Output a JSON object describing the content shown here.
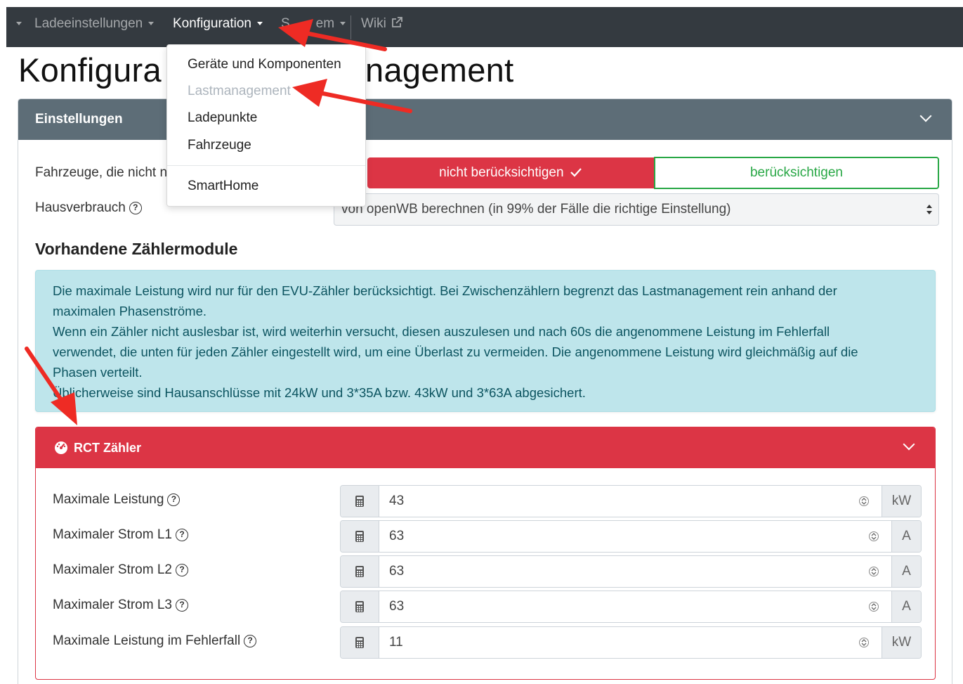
{
  "navbar": {
    "items": [
      {
        "label": "Ladeeinstellungen",
        "active": false
      },
      {
        "label": "Konfiguration",
        "active": true
      },
      {
        "label": "System",
        "active": false
      },
      {
        "label": "Wiki",
        "active": false
      }
    ],
    "system_visible_label": "S       em"
  },
  "dropdown": {
    "items": [
      {
        "label": "Geräte und Komponenten",
        "disabled": false
      },
      {
        "label": "Lastmanagement",
        "disabled": true
      },
      {
        "label": "Ladepunkte",
        "disabled": false
      },
      {
        "label": "Fahrzeuge",
        "disabled": false
      },
      {
        "label": "SmartHome",
        "disabled": false
      }
    ]
  },
  "page": {
    "title_left": "Konfigura",
    "title_right": "nagement"
  },
  "settings_card": {
    "title": "Einstellungen",
    "vehicles_label": "Fahrzeuge, die nicht n",
    "toggle_off_label": "nicht berücksichtigen",
    "toggle_on_label": "berücksichtigen",
    "house_label": "Hausverbrauch",
    "house_select_value": "von openWB berechnen (in 99% der Fälle die richtige Einstellung)",
    "section_title": "Vorhandene Zählermodule",
    "alert_lines": [
      "Die maximale Leistung wird nur für den EVU-Zähler berücksichtigt. Bei Zwischenzählern begrenzt das Lastmanagement rein anhand der",
      "maximalen Phasenströme.",
      "Wenn ein Zähler nicht auslesbar ist, wird weiterhin versucht, diesen auszulesen und nach 60s die angenommene Leistung im Fehlerfall",
      "verwendet, die unten für jeden Zähler eingestellt wird, um eine Überlast zu vermeiden. Die angenommene Leistung wird gleichmäßig auf die",
      "Phasen verteilt.",
      "Üblicherweise sind Hausanschlüsse mit 24kW und 3*35A bzw. 43kW und 3*63A abgesichert."
    ]
  },
  "rct_card": {
    "title": "RCT Zähler",
    "fields": [
      {
        "label": "Maximale Leistung",
        "value": "43",
        "unit": "kW"
      },
      {
        "label": "Maximaler Strom L1",
        "value": "63",
        "unit": "A"
      },
      {
        "label": "Maximaler Strom L2",
        "value": "63",
        "unit": "A"
      },
      {
        "label": "Maximaler Strom L3",
        "value": "63",
        "unit": "A"
      },
      {
        "label": "Maximale Leistung im Fehlerfall",
        "value": "11",
        "unit": "kW"
      }
    ]
  },
  "help_glyph": "?",
  "colors": {
    "navbar": "#343a40",
    "card_header": "#5d6d77",
    "danger": "#dc3545",
    "success": "#28a745",
    "alert_bg": "#bee5eb",
    "annotation_arrow": "#ee2b24"
  }
}
